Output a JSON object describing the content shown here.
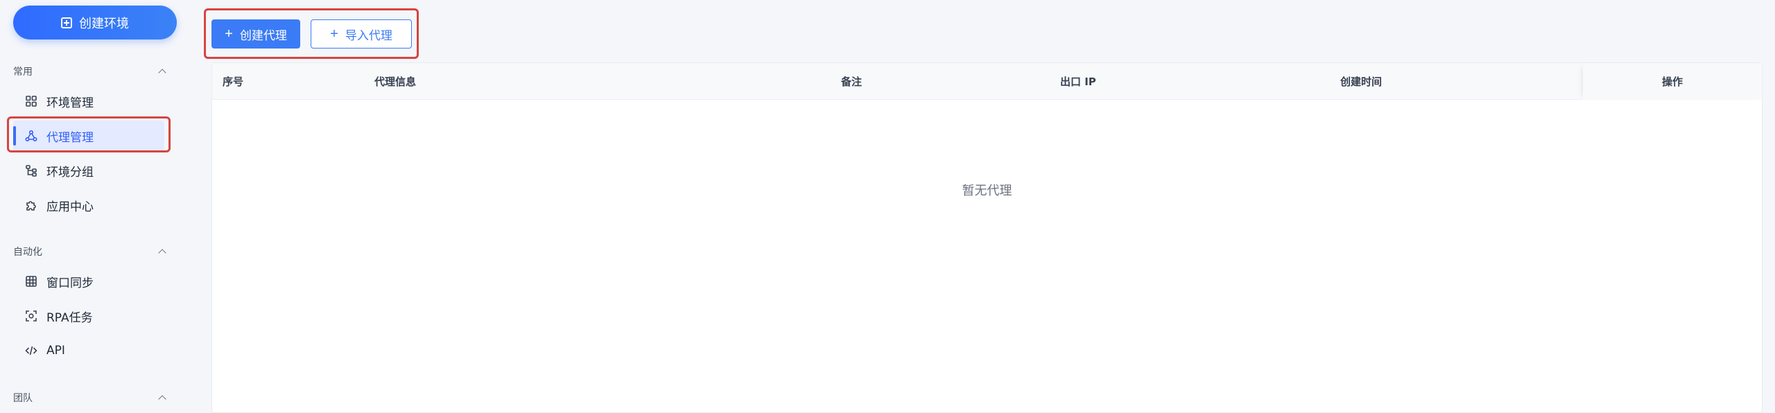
{
  "sidebar": {
    "create_env_label": "创建环境",
    "sections": [
      {
        "title": "常用"
      },
      {
        "title": "自动化"
      },
      {
        "title": "团队"
      }
    ],
    "items": [
      {
        "label": "环境管理",
        "icon": "grid-icon"
      },
      {
        "label": "代理管理",
        "icon": "proxy-network-icon",
        "active": true
      },
      {
        "label": "环境分组",
        "icon": "group-tree-icon"
      },
      {
        "label": "应用中心",
        "icon": "puzzle-icon"
      },
      {
        "label": "窗口同步",
        "icon": "window-grid-icon"
      },
      {
        "label": "RPA任务",
        "icon": "rpa-scan-icon"
      },
      {
        "label": "API",
        "icon": "code-icon"
      }
    ]
  },
  "toolbar": {
    "create_label": "创建代理",
    "import_label": "导入代理"
  },
  "table": {
    "columns": [
      "序号",
      "代理信息",
      "备注",
      "出口 IP",
      "创建时间",
      "操作"
    ],
    "empty_text": "暂无代理"
  },
  "colors": {
    "primary": "#3b7bf6",
    "active_bg": "#e4eaff",
    "highlight_border": "#d64541"
  }
}
